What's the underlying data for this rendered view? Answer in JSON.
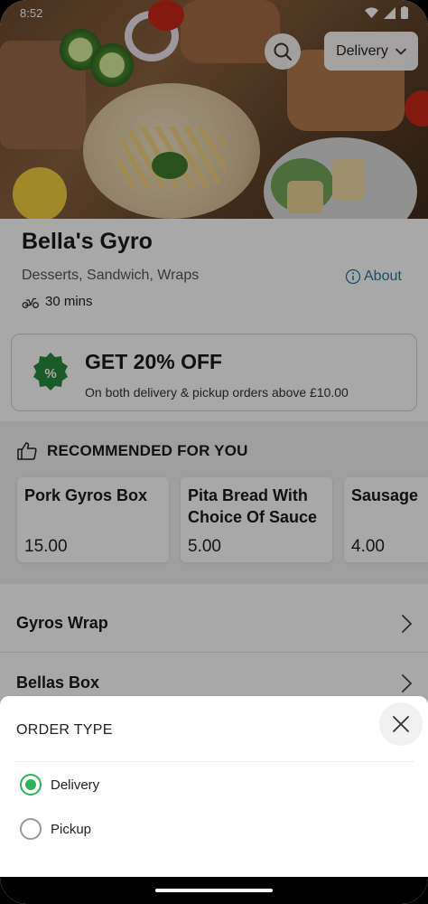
{
  "status_bar": {
    "time": "8:52"
  },
  "header": {
    "order_type_selected": "Delivery",
    "search_icon": "search-icon"
  },
  "restaurant": {
    "name": "Bella's Gyro",
    "cuisines": "Desserts, Sandwich, Wraps",
    "about_label": "About",
    "eta": "30 mins"
  },
  "offer": {
    "title": "GET 20% OFF",
    "subtitle": "On both delivery & pickup orders above £10.00"
  },
  "recommended": {
    "heading": "RECOMMENDED FOR YOU",
    "items": [
      {
        "name": "Pork Gyros Box",
        "price": "15.00"
      },
      {
        "name": "Pita Bread With Choice Of Sauce",
        "price": "5.00"
      },
      {
        "name": "Sausage",
        "price": "4.00"
      }
    ]
  },
  "categories": [
    {
      "name": "Gyros Wrap"
    },
    {
      "name": "Bellas Box"
    }
  ],
  "sheet": {
    "title": "ORDER TYPE",
    "options": [
      {
        "label": "Delivery",
        "selected": true
      },
      {
        "label": "Pickup",
        "selected": false
      }
    ]
  },
  "colors": {
    "accent_green": "#2db35a",
    "link_blue": "#1f7a99",
    "offer_badge": "#2a8a3c"
  }
}
